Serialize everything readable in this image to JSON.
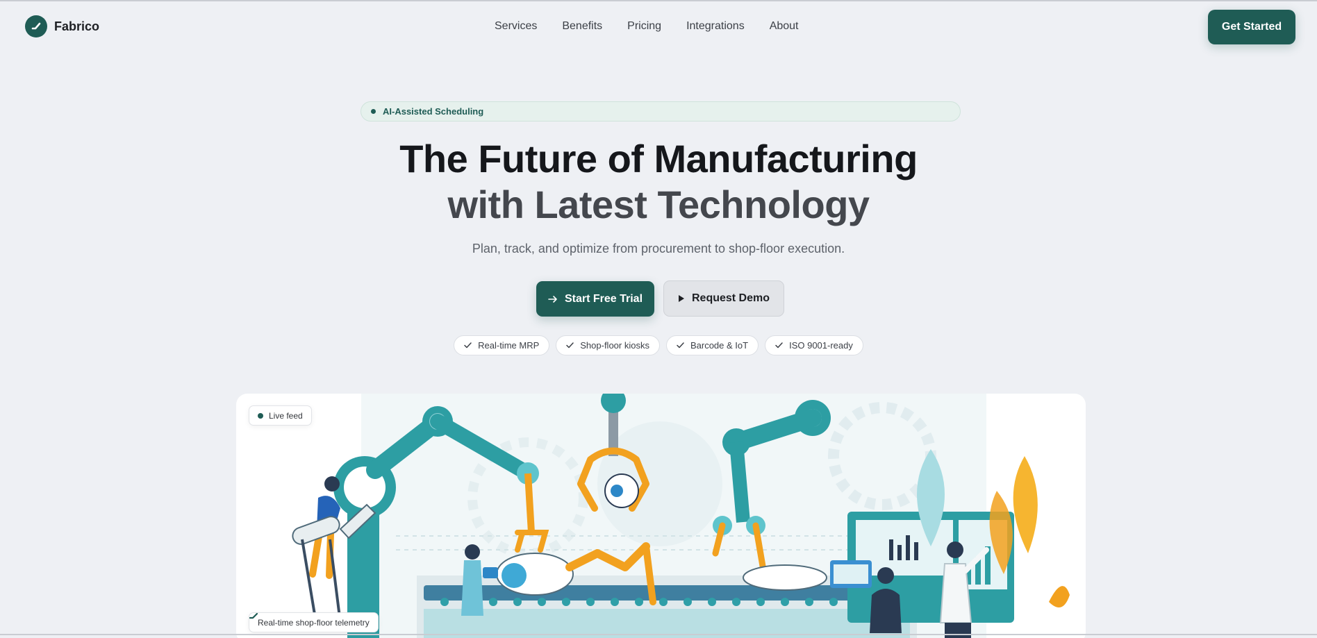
{
  "brand": {
    "name": "Fabrico",
    "logo_icon": "check-mark-icon",
    "accent": "#1f5c55"
  },
  "nav": {
    "items": [
      "Services",
      "Benefits",
      "Pricing",
      "Integrations",
      "About"
    ]
  },
  "header": {
    "cta_label": "Get Started"
  },
  "hero": {
    "badge": "AI-Assisted Scheduling",
    "title_line1": "The Future of Manufacturing",
    "title_line2": "with Latest Technology",
    "subtitle": "Plan, track, and optimize from procurement to shop-floor execution.",
    "primary_cta": "Start Free Trial",
    "secondary_cta": "Request Demo",
    "features": [
      "Real-time MRP",
      "Shop-floor kiosks",
      "Barcode & IoT",
      "ISO 9001-ready"
    ]
  },
  "media": {
    "live_label": "Live feed",
    "telemetry_label": "Real-time shop-floor telemetry"
  }
}
